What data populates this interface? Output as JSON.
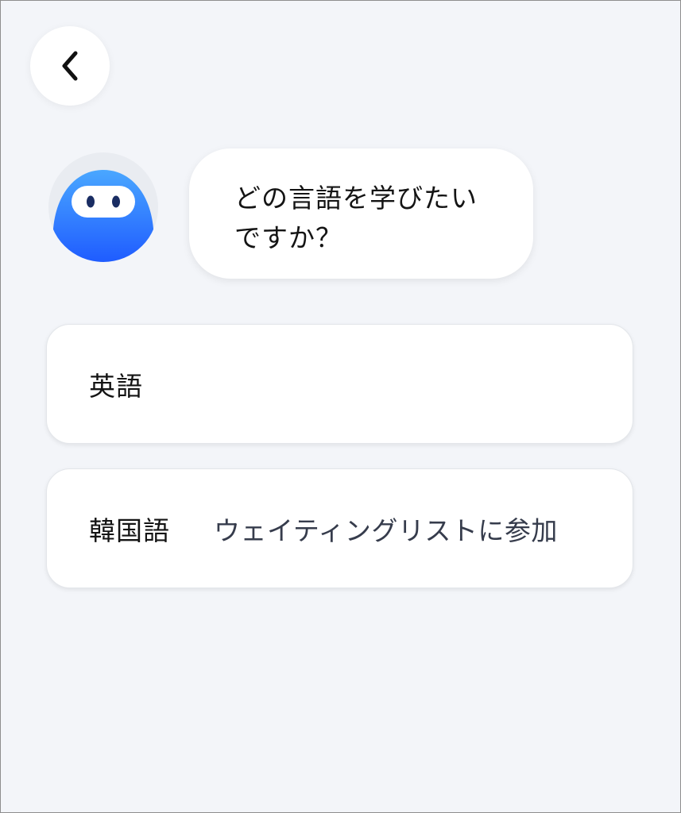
{
  "navigation": {
    "back_icon": "chevron-left-icon"
  },
  "assistant": {
    "avatar_icon": "robot-mascot-icon",
    "accent_color": "#2f7bff",
    "question": "どの言語を学びたい\nですか？"
  },
  "options": [
    {
      "label": "英語",
      "waitlist_label": ""
    },
    {
      "label": "韓国語",
      "waitlist_label": "ウェイティングリストに参加"
    }
  ]
}
